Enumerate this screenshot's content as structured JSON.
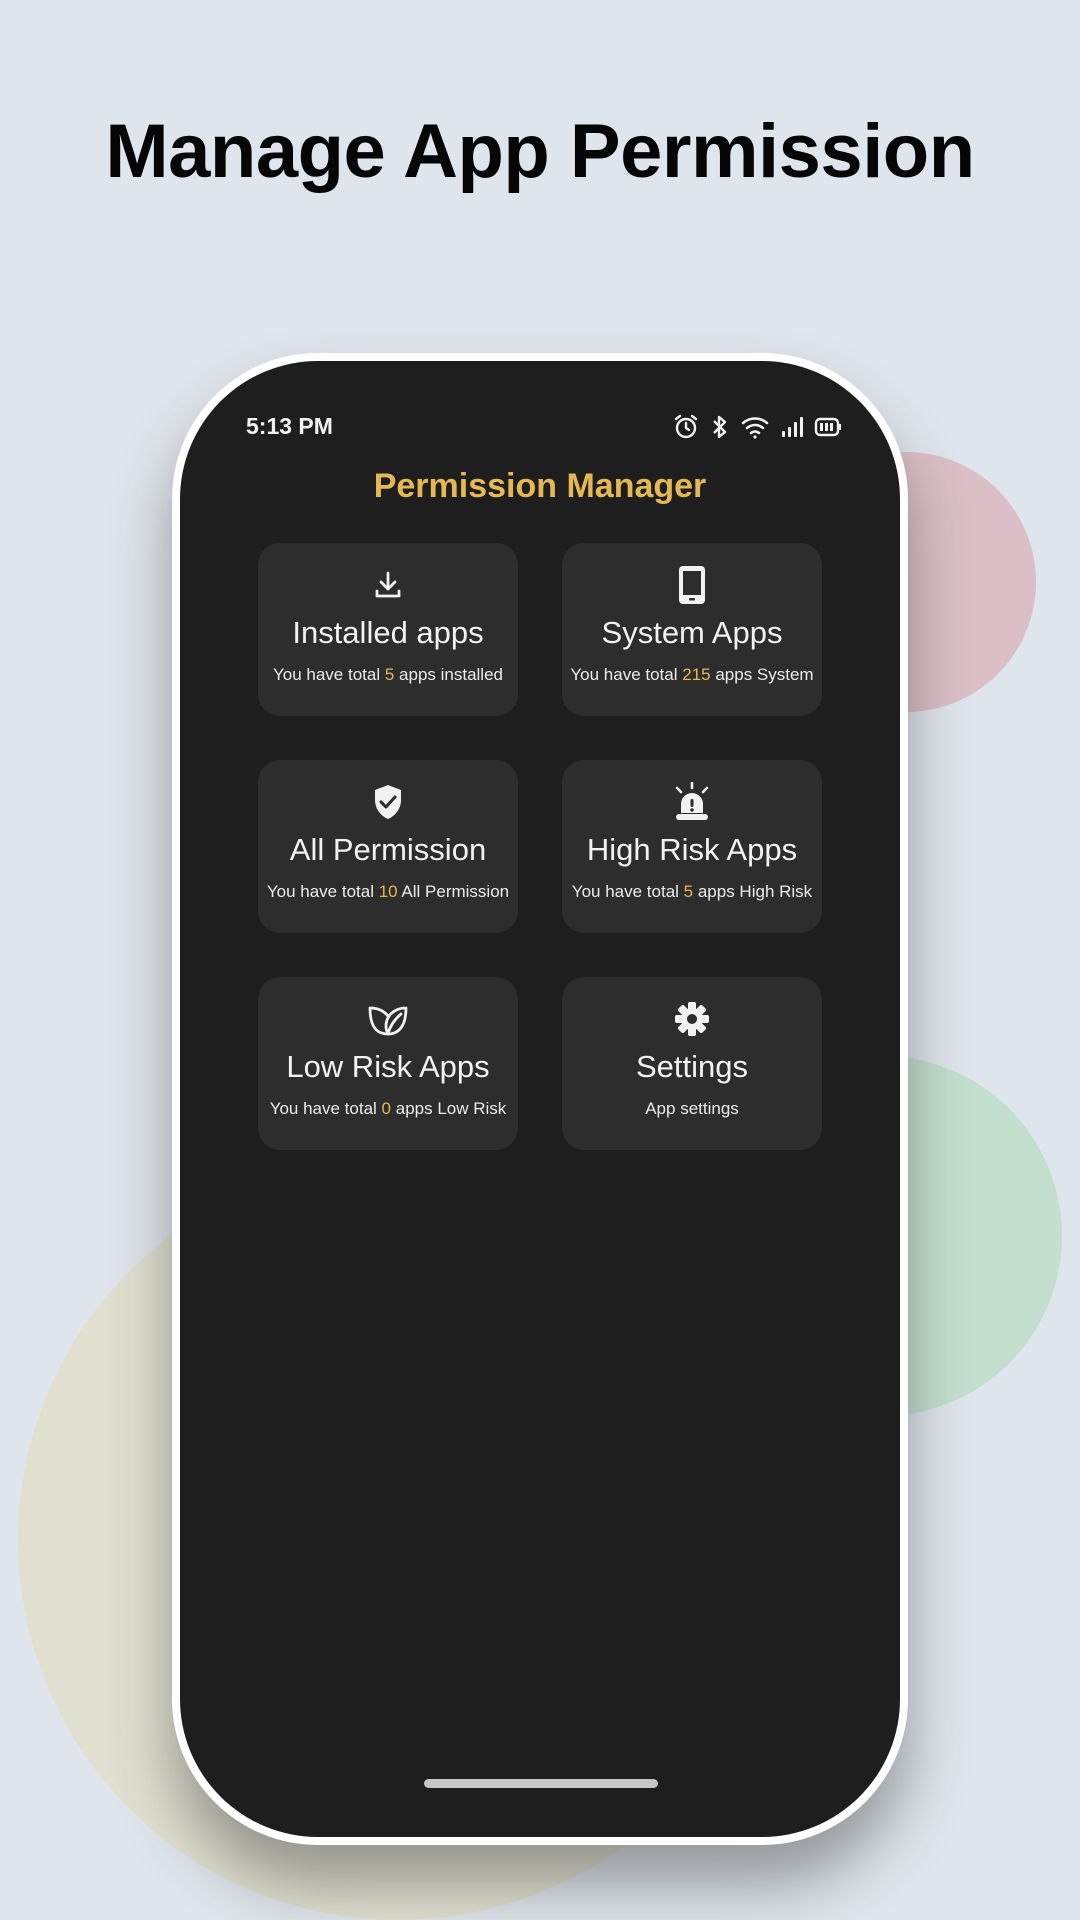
{
  "headline": "Manage App Permission",
  "status": {
    "time": "5:13 PM"
  },
  "app": {
    "title": "Permission Manager"
  },
  "cards": [
    {
      "title": "Installed apps",
      "prefix": "You have total ",
      "count": "5",
      "suffix": " apps installed",
      "icon": "download-icon"
    },
    {
      "title": "System Apps",
      "prefix": "You have total ",
      "count": "215",
      "suffix": " apps System",
      "icon": "phone-icon"
    },
    {
      "title": "All Permission",
      "prefix": "You have total ",
      "count": "10",
      "suffix": " All Permission",
      "icon": "shield-check-icon"
    },
    {
      "title": "High Risk Apps",
      "prefix": "You have total ",
      "count": "5",
      "suffix": " apps High Risk",
      "icon": "alarm-siren-icon"
    },
    {
      "title": "Low Risk Apps",
      "prefix": "You have total ",
      "count": "0",
      "suffix": " apps Low Risk",
      "icon": "leaf-icon"
    },
    {
      "title": "Settings",
      "subtitle": "App settings",
      "icon": "gear-icon"
    }
  ],
  "colors": {
    "accent": "#e6b855",
    "screen_bg": "#1e1e1e",
    "card_bg": "#2d2d2d"
  }
}
